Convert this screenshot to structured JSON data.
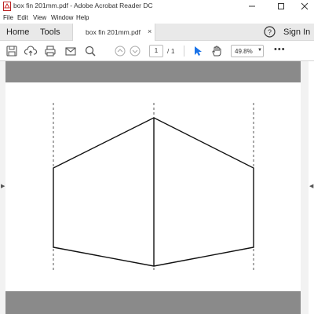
{
  "window": {
    "title": "box fin 201mm.pdf - Adobe Acrobat Reader DC",
    "minimize_icon": "minimize-icon",
    "maximize_icon": "maximize-icon",
    "close_icon": "close-icon"
  },
  "menu": {
    "items": [
      "File",
      "Edit",
      "View",
      "Window",
      "Help"
    ]
  },
  "tabs": {
    "home": "Home",
    "tools": "Tools",
    "document": "box fin 201mm.pdf",
    "close": "×",
    "sign_in": "Sign In"
  },
  "toolbar": {
    "icons": [
      "save-icon",
      "upload-icon",
      "print-icon",
      "email-icon",
      "search-icon",
      "prev-page-icon",
      "next-page-icon",
      "select-cursor-icon",
      "hand-tool-icon"
    ],
    "page_current": "1",
    "page_separator": "/",
    "page_total": "1",
    "zoom": "49.8%",
    "more": "•••"
  },
  "colors": {
    "gray_band": "#8a8a8a",
    "tab_bar": "#e9e9e9",
    "cursor_blue": "#1a73e8"
  }
}
